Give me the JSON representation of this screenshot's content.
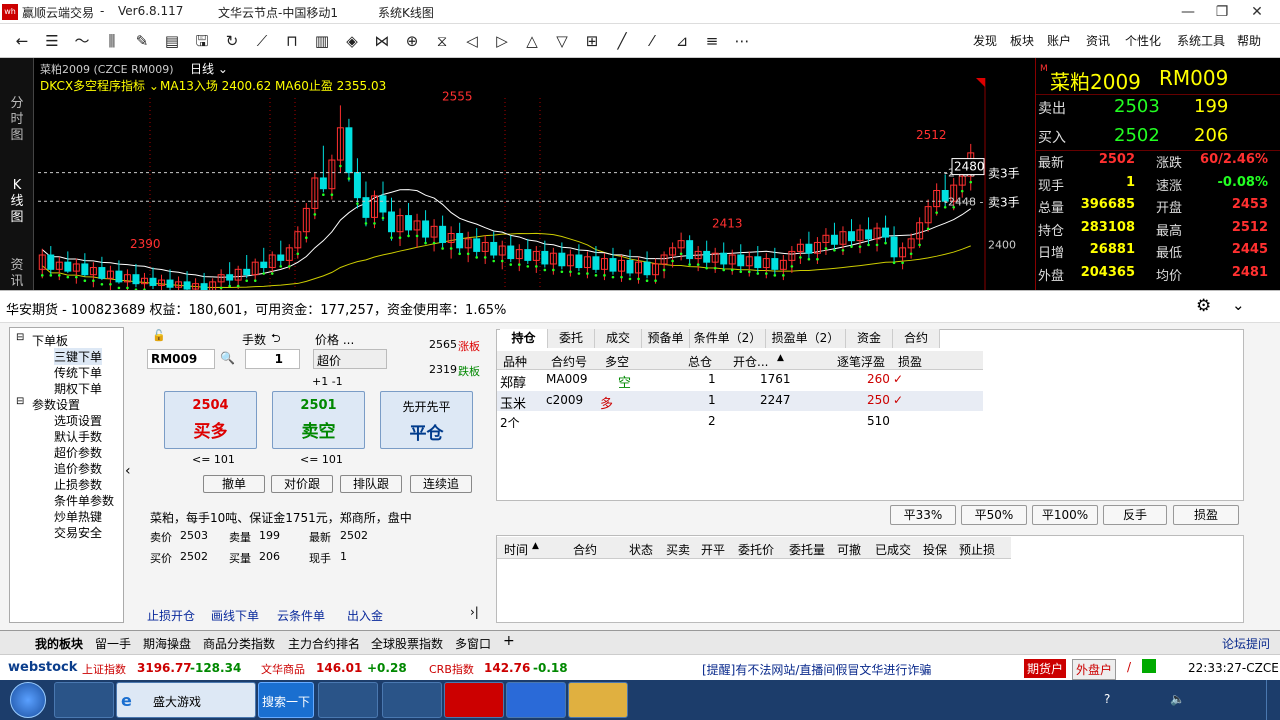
{
  "app": {
    "title": "赢顺云端交易",
    "version": "Ver6.8.117",
    "node": "文华云节点-中国移动1",
    "view": "系统K线图"
  },
  "menu": [
    "发现",
    "板块",
    "账户",
    "资讯",
    "个性化",
    "系统工具",
    "帮助"
  ],
  "toolbar_icons": [
    "back-icon",
    "list-icon",
    "line-chart-icon",
    "kline-icon",
    "draw-icon",
    "report-icon",
    "save-icon",
    "refresh-icon",
    "trend-icon",
    "period-icon",
    "bar-icon",
    "indicator-icon",
    "compare-icon",
    "overlay-icon",
    "cycle-icon",
    "arrow-left-icon",
    "arrow-right-icon",
    "arrow-up-icon",
    "arrow-down-icon",
    "layout-icon",
    "pen-icon",
    "brush-icon",
    "ruler-icon",
    "text-icon",
    "more-icon"
  ],
  "chart": {
    "symbol": "菜粕2009 (CZCE RM009)",
    "period": "日线",
    "indicator": "DKCX多空程序指标",
    "ma13": "MA13入场 2400.62",
    "ma60": "MA60止盈 2355.03",
    "labels": {
      "high": "2555",
      "low_left": "2390",
      "mid": "2413",
      "right_high": "2512"
    },
    "order_lines": [
      {
        "price": "2480",
        "price_box": "2480",
        "label": "卖3手"
      },
      {
        "price": "2448",
        "label": "卖3手"
      }
    ],
    "axis_label": "2400",
    "side_tabs": [
      "分时图",
      "K线图",
      "资讯"
    ]
  },
  "chart_data": {
    "type": "candlestick",
    "title": "菜粕2009",
    "ylim": [
      2340,
      2580
    ],
    "candles": [
      {
        "o": 2372,
        "h": 2395,
        "l": 2362,
        "c": 2388
      },
      {
        "o": 2388,
        "h": 2398,
        "l": 2366,
        "c": 2372
      },
      {
        "o": 2372,
        "h": 2386,
        "l": 2360,
        "c": 2380
      },
      {
        "o": 2380,
        "h": 2392,
        "l": 2368,
        "c": 2370
      },
      {
        "o": 2370,
        "h": 2384,
        "l": 2356,
        "c": 2378
      },
      {
        "o": 2378,
        "h": 2390,
        "l": 2364,
        "c": 2366
      },
      {
        "o": 2366,
        "h": 2380,
        "l": 2352,
        "c": 2374
      },
      {
        "o": 2374,
        "h": 2386,
        "l": 2360,
        "c": 2362
      },
      {
        "o": 2362,
        "h": 2376,
        "l": 2348,
        "c": 2370
      },
      {
        "o": 2370,
        "h": 2382,
        "l": 2356,
        "c": 2358
      },
      {
        "o": 2358,
        "h": 2372,
        "l": 2346,
        "c": 2366
      },
      {
        "o": 2366,
        "h": 2378,
        "l": 2352,
        "c": 2356
      },
      {
        "o": 2356,
        "h": 2368,
        "l": 2344,
        "c": 2362
      },
      {
        "o": 2362,
        "h": 2374,
        "l": 2350,
        "c": 2354
      },
      {
        "o": 2354,
        "h": 2366,
        "l": 2342,
        "c": 2360
      },
      {
        "o": 2360,
        "h": 2372,
        "l": 2348,
        "c": 2352
      },
      {
        "o": 2352,
        "h": 2364,
        "l": 2342,
        "c": 2358
      },
      {
        "o": 2358,
        "h": 2370,
        "l": 2346,
        "c": 2350
      },
      {
        "o": 2350,
        "h": 2362,
        "l": 2342,
        "c": 2356
      },
      {
        "o": 2356,
        "h": 2368,
        "l": 2344,
        "c": 2348
      },
      {
        "o": 2348,
        "h": 2362,
        "l": 2342,
        "c": 2358
      },
      {
        "o": 2358,
        "h": 2372,
        "l": 2348,
        "c": 2366
      },
      {
        "o": 2366,
        "h": 2380,
        "l": 2354,
        "c": 2360
      },
      {
        "o": 2360,
        "h": 2376,
        "l": 2350,
        "c": 2372
      },
      {
        "o": 2372,
        "h": 2388,
        "l": 2362,
        "c": 2366
      },
      {
        "o": 2366,
        "h": 2384,
        "l": 2358,
        "c": 2380
      },
      {
        "o": 2380,
        "h": 2396,
        "l": 2368,
        "c": 2374
      },
      {
        "o": 2374,
        "h": 2392,
        "l": 2366,
        "c": 2388
      },
      {
        "o": 2388,
        "h": 2404,
        "l": 2376,
        "c": 2382
      },
      {
        "o": 2382,
        "h": 2400,
        "l": 2372,
        "c": 2396
      },
      {
        "o": 2396,
        "h": 2420,
        "l": 2384,
        "c": 2414
      },
      {
        "o": 2414,
        "h": 2446,
        "l": 2402,
        "c": 2440
      },
      {
        "o": 2440,
        "h": 2480,
        "l": 2428,
        "c": 2474
      },
      {
        "o": 2474,
        "h": 2510,
        "l": 2458,
        "c": 2462
      },
      {
        "o": 2462,
        "h": 2500,
        "l": 2450,
        "c": 2494
      },
      {
        "o": 2494,
        "h": 2555,
        "l": 2480,
        "c": 2530
      },
      {
        "o": 2530,
        "h": 2540,
        "l": 2470,
        "c": 2480
      },
      {
        "o": 2480,
        "h": 2496,
        "l": 2440,
        "c": 2452
      },
      {
        "o": 2452,
        "h": 2470,
        "l": 2420,
        "c": 2430
      },
      {
        "o": 2430,
        "h": 2460,
        "l": 2418,
        "c": 2454
      },
      {
        "o": 2454,
        "h": 2470,
        "l": 2426,
        "c": 2436
      },
      {
        "o": 2436,
        "h": 2452,
        "l": 2404,
        "c": 2414
      },
      {
        "o": 2414,
        "h": 2440,
        "l": 2398,
        "c": 2432
      },
      {
        "o": 2432,
        "h": 2446,
        "l": 2408,
        "c": 2416
      },
      {
        "o": 2416,
        "h": 2434,
        "l": 2396,
        "c": 2426
      },
      {
        "o": 2426,
        "h": 2438,
        "l": 2400,
        "c": 2408
      },
      {
        "o": 2408,
        "h": 2428,
        "l": 2392,
        "c": 2420
      },
      {
        "o": 2420,
        "h": 2432,
        "l": 2396,
        "c": 2402
      },
      {
        "o": 2402,
        "h": 2420,
        "l": 2384,
        "c": 2412
      },
      {
        "o": 2412,
        "h": 2424,
        "l": 2390,
        "c": 2396
      },
      {
        "o": 2396,
        "h": 2414,
        "l": 2380,
        "c": 2406
      },
      {
        "o": 2406,
        "h": 2418,
        "l": 2386,
        "c": 2392
      },
      {
        "o": 2392,
        "h": 2410,
        "l": 2378,
        "c": 2402
      },
      {
        "o": 2402,
        "h": 2414,
        "l": 2384,
        "c": 2388
      },
      {
        "o": 2388,
        "h": 2404,
        "l": 2372,
        "c": 2398
      },
      {
        "o": 2398,
        "h": 2410,
        "l": 2380,
        "c": 2384
      },
      {
        "o": 2384,
        "h": 2400,
        "l": 2370,
        "c": 2394
      },
      {
        "o": 2394,
        "h": 2406,
        "l": 2378,
        "c": 2382
      },
      {
        "o": 2382,
        "h": 2398,
        "l": 2368,
        "c": 2392
      },
      {
        "o": 2392,
        "h": 2404,
        "l": 2374,
        "c": 2378
      },
      {
        "o": 2378,
        "h": 2396,
        "l": 2366,
        "c": 2390
      },
      {
        "o": 2390,
        "h": 2402,
        "l": 2372,
        "c": 2376
      },
      {
        "o": 2376,
        "h": 2394,
        "l": 2364,
        "c": 2388
      },
      {
        "o": 2388,
        "h": 2400,
        "l": 2370,
        "c": 2374
      },
      {
        "o": 2374,
        "h": 2392,
        "l": 2362,
        "c": 2386
      },
      {
        "o": 2386,
        "h": 2398,
        "l": 2368,
        "c": 2372
      },
      {
        "o": 2372,
        "h": 2390,
        "l": 2360,
        "c": 2384
      },
      {
        "o": 2384,
        "h": 2396,
        "l": 2366,
        "c": 2370
      },
      {
        "o": 2370,
        "h": 2388,
        "l": 2358,
        "c": 2382
      },
      {
        "o": 2382,
        "h": 2394,
        "l": 2364,
        "c": 2368
      },
      {
        "o": 2368,
        "h": 2386,
        "l": 2356,
        "c": 2380
      },
      {
        "o": 2380,
        "h": 2392,
        "l": 2362,
        "c": 2366
      },
      {
        "o": 2366,
        "h": 2384,
        "l": 2356,
        "c": 2378
      },
      {
        "o": 2378,
        "h": 2392,
        "l": 2362,
        "c": 2388
      },
      {
        "o": 2388,
        "h": 2402,
        "l": 2374,
        "c": 2396
      },
      {
        "o": 2396,
        "h": 2413,
        "l": 2382,
        "c": 2404
      },
      {
        "o": 2404,
        "h": 2410,
        "l": 2378,
        "c": 2384
      },
      {
        "o": 2384,
        "h": 2398,
        "l": 2370,
        "c": 2392
      },
      {
        "o": 2392,
        "h": 2404,
        "l": 2374,
        "c": 2380
      },
      {
        "o": 2380,
        "h": 2396,
        "l": 2368,
        "c": 2390
      },
      {
        "o": 2390,
        "h": 2402,
        "l": 2372,
        "c": 2378
      },
      {
        "o": 2378,
        "h": 2394,
        "l": 2366,
        "c": 2388
      },
      {
        "o": 2388,
        "h": 2400,
        "l": 2370,
        "c": 2376
      },
      {
        "o": 2376,
        "h": 2392,
        "l": 2364,
        "c": 2386
      },
      {
        "o": 2386,
        "h": 2398,
        "l": 2368,
        "c": 2374
      },
      {
        "o": 2374,
        "h": 2390,
        "l": 2362,
        "c": 2384
      },
      {
        "o": 2384,
        "h": 2396,
        "l": 2366,
        "c": 2372
      },
      {
        "o": 2372,
        "h": 2388,
        "l": 2360,
        "c": 2382
      },
      {
        "o": 2382,
        "h": 2398,
        "l": 2368,
        "c": 2392
      },
      {
        "o": 2392,
        "h": 2406,
        "l": 2378,
        "c": 2400
      },
      {
        "o": 2400,
        "h": 2414,
        "l": 2384,
        "c": 2390
      },
      {
        "o": 2390,
        "h": 2408,
        "l": 2378,
        "c": 2402
      },
      {
        "o": 2402,
        "h": 2418,
        "l": 2388,
        "c": 2410
      },
      {
        "o": 2410,
        "h": 2424,
        "l": 2394,
        "c": 2400
      },
      {
        "o": 2400,
        "h": 2420,
        "l": 2388,
        "c": 2414
      },
      {
        "o": 2414,
        "h": 2428,
        "l": 2396,
        "c": 2404
      },
      {
        "o": 2404,
        "h": 2422,
        "l": 2390,
        "c": 2416
      },
      {
        "o": 2416,
        "h": 2430,
        "l": 2398,
        "c": 2406
      },
      {
        "o": 2406,
        "h": 2424,
        "l": 2392,
        "c": 2418
      },
      {
        "o": 2418,
        "h": 2432,
        "l": 2400,
        "c": 2408
      },
      {
        "o": 2408,
        "h": 2420,
        "l": 2380,
        "c": 2386
      },
      {
        "o": 2386,
        "h": 2402,
        "l": 2372,
        "c": 2396
      },
      {
        "o": 2396,
        "h": 2412,
        "l": 2384,
        "c": 2406
      },
      {
        "o": 2406,
        "h": 2430,
        "l": 2396,
        "c": 2424
      },
      {
        "o": 2424,
        "h": 2450,
        "l": 2414,
        "c": 2442
      },
      {
        "o": 2442,
        "h": 2468,
        "l": 2432,
        "c": 2460
      },
      {
        "o": 2460,
        "h": 2478,
        "l": 2440,
        "c": 2448
      },
      {
        "o": 2448,
        "h": 2474,
        "l": 2438,
        "c": 2466
      },
      {
        "o": 2466,
        "h": 2488,
        "l": 2452,
        "c": 2476
      },
      {
        "o": 2476,
        "h": 2512,
        "l": 2460,
        "c": 2502
      }
    ]
  },
  "quote": {
    "name": "菜粕2009",
    "code": "RM009",
    "sell_label": "卖出",
    "sell_price": "2503",
    "sell_vol": "199",
    "buy_label": "买入",
    "buy_price": "2502",
    "buy_vol": "206",
    "rows": [
      {
        "l1": "最新",
        "v1": "2502",
        "l2": "涨跌",
        "v2": "60/2.46%"
      },
      {
        "l1": "现手",
        "v1": "1",
        "l2": "速涨",
        "v2": "-0.08%"
      },
      {
        "l1": "总量",
        "v1": "396685",
        "l2": "开盘",
        "v2": "2453"
      },
      {
        "l1": "持仓",
        "v1": "283108",
        "l2": "最高",
        "v2": "2512"
      },
      {
        "l1": "日增",
        "v1": "26881",
        "l2": "最低",
        "v2": "2445"
      },
      {
        "l1": "外盘",
        "v1": "204365",
        "l2": "均价",
        "v2": "2481"
      }
    ]
  },
  "account": {
    "header": "华安期货 - 100823689  权益：180,601，可用资金：177,257，资金使用率：1.65%"
  },
  "tree": {
    "groups": [
      {
        "label": "下单板",
        "items": [
          "三键下单",
          "传统下单",
          "期权下单"
        ]
      },
      {
        "label": "参数设置",
        "items": [
          "选项设置",
          "默认手数",
          "超价参数",
          "追价参数",
          "止损参数",
          "条件单参数",
          "炒单热键",
          "交易安全"
        ]
      }
    ]
  },
  "order": {
    "contract": "RM009",
    "qty_label": "手数",
    "qty": "1",
    "price_label": "价格 ...",
    "price_mode": "超价",
    "offset": "+1  -1",
    "limit_up": "2565",
    "limit_up_label": "涨板",
    "limit_down": "2319",
    "limit_down_label": "跌板",
    "buy": {
      "price": "2504",
      "label": "买多",
      "max": "<= 101"
    },
    "sell": {
      "price": "2501",
      "label": "卖空",
      "max": "<= 101"
    },
    "close": {
      "price": "先开先平",
      "label": "平仓"
    },
    "actions": [
      "撤单",
      "对价跟",
      "排队跟",
      "连续追"
    ],
    "info": "菜粕，每手10吨、保证金1751元，郑商所，盘中",
    "mini": [
      {
        "l": "卖价",
        "v": "2503",
        "l2": "卖量",
        "v2": "199",
        "l3": "最新",
        "v3": "2502"
      },
      {
        "l": "买价",
        "v": "2502",
        "l2": "买量",
        "v2": "206",
        "l3": "现手",
        "v3": "1"
      }
    ],
    "links": [
      "止损开仓",
      "画线下单",
      "云条件单",
      "出入金"
    ]
  },
  "positions": {
    "tabs": [
      "持仓",
      "委托",
      "成交",
      "预备单",
      "条件单（2）",
      "损盈单（2）",
      "资金",
      "合约"
    ],
    "headers": [
      "品种",
      "合约号",
      "多空",
      "总仓",
      "开仓...",
      "逐笔浮盈",
      "损盈"
    ],
    "rows": [
      {
        "name": "郑醇",
        "code": "MA009",
        "side": "空",
        "qty": "1",
        "open": "1761",
        "pnl": "260"
      },
      {
        "name": "玉米",
        "code": "c2009",
        "side": "多",
        "qty": "1",
        "open": "2247",
        "pnl": "250"
      }
    ],
    "total": {
      "name": "2个",
      "qty": "2",
      "pnl": "510"
    },
    "quick": [
      "平33%",
      "平50%",
      "平100%",
      "反手",
      "损盈"
    ],
    "order_headers": [
      "时间",
      "合约",
      "状态",
      "买卖",
      "开平",
      "委托价",
      "委托量",
      "可撤",
      "已成交",
      "投保",
      "预止损"
    ]
  },
  "bottom_tabs": [
    "我的板块",
    "留一手",
    "期海操盘",
    "商品分类指数",
    "主力合约排名",
    "全球股票指数",
    "多窗口",
    "论坛提问"
  ],
  "ticker": {
    "logo": "webstock",
    "items": [
      {
        "name": "上证指数",
        "val": "3196.77",
        "chg": "-128.34"
      },
      {
        "name": "文华商品",
        "val": "146.01",
        "chg": "+0.28"
      },
      {
        "name": "CRB指数",
        "val": "142.76",
        "chg": "-0.18"
      }
    ],
    "notice": "[提醒]有不法网站/直播间假冒文华进行诈骗",
    "btn1": "期货户",
    "btn2": "外盘户",
    "time": "22:33:27-CZCE"
  },
  "taskbar": {
    "ie_title": "盛大游戏",
    "search": "搜索一下"
  }
}
